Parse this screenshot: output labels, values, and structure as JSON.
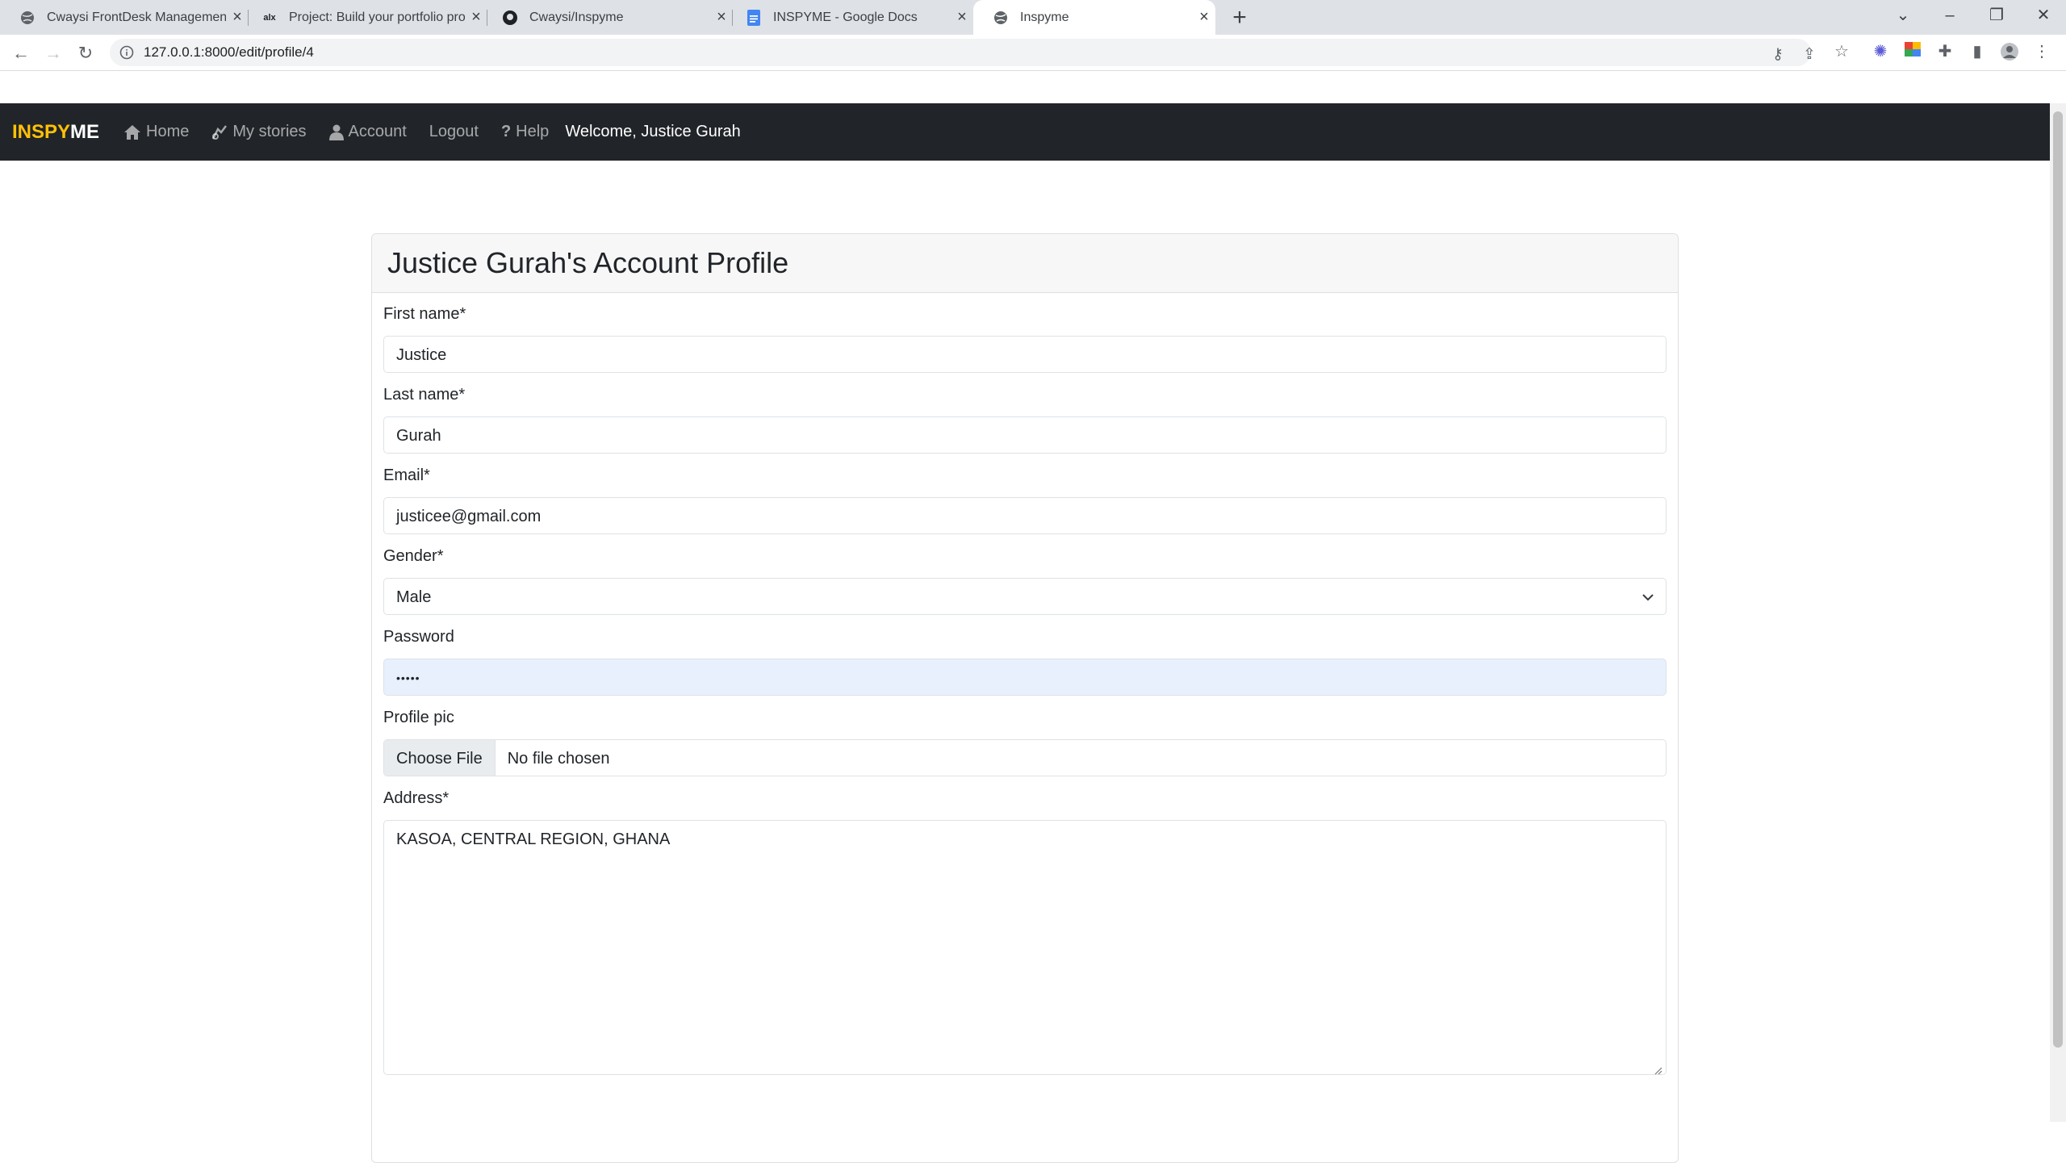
{
  "browser": {
    "tabs": [
      {
        "title": "Cwaysi FrontDesk Management",
        "icon": "globe-icon",
        "active": false
      },
      {
        "title": "Project: Build your portfolio proje",
        "icon": "alx-icon",
        "active": false
      },
      {
        "title": "Cwaysi/Inspyme",
        "icon": "github-icon",
        "active": false
      },
      {
        "title": "INSPYME - Google Docs",
        "icon": "google-docs-icon",
        "active": false
      },
      {
        "title": "Inspyme",
        "icon": "globe-icon",
        "active": true
      }
    ],
    "url": "127.0.0.1:8000/edit/profile/4"
  },
  "navbar": {
    "brand_part1": "INSPY",
    "brand_part2": "ME",
    "links": [
      {
        "label": "Home",
        "icon": "home-icon"
      },
      {
        "label": "My stories",
        "icon": "story-icon"
      },
      {
        "label": "Account",
        "icon": "user-icon"
      },
      {
        "label": "Logout",
        "icon": ""
      },
      {
        "label": "Help",
        "icon": "question-icon"
      }
    ],
    "welcome": "Welcome, Justice Gurah"
  },
  "profile": {
    "title": "Justice Gurah's Account Profile",
    "fields": {
      "first_name": {
        "label": "First name*",
        "value": "Justice"
      },
      "last_name": {
        "label": "Last name*",
        "value": "Gurah"
      },
      "email": {
        "label": "Email*",
        "value": "justicee@gmail.com"
      },
      "gender": {
        "label": "Gender*",
        "value": "Male"
      },
      "password": {
        "label": "Password",
        "value": "•••••"
      },
      "profile_pic": {
        "label": "Profile pic",
        "button": "Choose File",
        "status": "No file chosen"
      },
      "address": {
        "label": "Address*",
        "value": "KASOA, CENTRAL REGION, GHANA"
      }
    }
  },
  "colors": {
    "navbar_bg": "#212529",
    "brand_accent": "#ffc107",
    "autofill_bg": "#e8f0fe"
  }
}
